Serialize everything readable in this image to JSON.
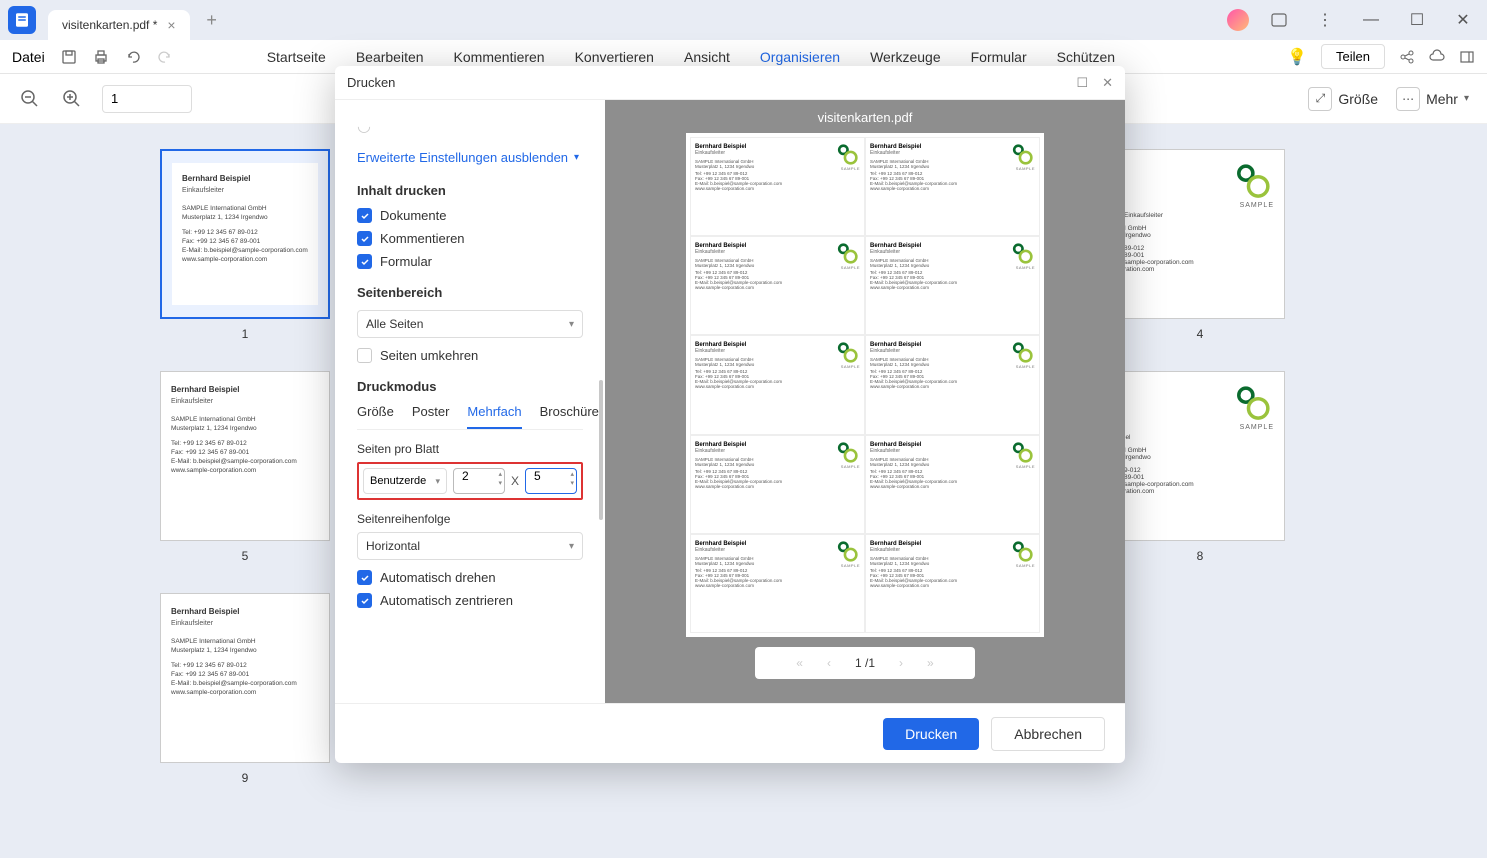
{
  "titlebar": {
    "tab_title": "visitenkarten.pdf *",
    "file_menu": "Datei"
  },
  "menu": {
    "start": "Startseite",
    "edit": "Bearbeiten",
    "comment": "Kommentieren",
    "convert": "Konvertieren",
    "view": "Ansicht",
    "organize": "Organisieren",
    "tools": "Werkzeuge",
    "form": "Formular",
    "protect": "Schützen",
    "share": "Teilen"
  },
  "sec": {
    "page_value": "1",
    "size": "Größe",
    "more": "Mehr"
  },
  "card": {
    "name": "Bernhard Beispiel",
    "role": "Einkaufsleiter",
    "company": "SAMPLE International GmbH",
    "address": "Musterplatz 1, 1234 Irgendwo",
    "tel": "Tel: +99 12 345 67 89-012",
    "fax": "Fax: +99 12 345 67 89-001",
    "email": "E-Mail: b.beispiel@sample-corporation.com",
    "web": "www.sample-corporation.com",
    "logo_text": "SAMPLE"
  },
  "thumbs": {
    "n1": "1",
    "n4": "4",
    "n5": "5",
    "n8": "8",
    "n9": "9"
  },
  "dialog": {
    "title": "Drucken",
    "advanced": "Erweiterte Einstellungen ausblenden",
    "content_title": "Inhalt drucken",
    "cb_documents": "Dokumente",
    "cb_comments": "Kommentieren",
    "cb_form": "Formular",
    "range_title": "Seitenbereich",
    "range_select": "Alle Seiten",
    "reverse": "Seiten umkehren",
    "mode_title": "Druckmodus",
    "tab_size": "Größe",
    "tab_poster": "Poster",
    "tab_multi": "Mehrfach",
    "tab_brochure": "Broschüre",
    "pages_per": "Seiten pro Blatt",
    "custom": "Benutzerde",
    "val_x": "2",
    "val_y": "5",
    "x_sep": "X",
    "order_title": "Seitenreihenfolge",
    "order_select": "Horizontal",
    "auto_rotate": "Automatisch drehen",
    "auto_center": "Automatisch zentrieren",
    "preview_file": "visitenkarten.pdf",
    "page_indicator": "1 /1",
    "btn_print": "Drucken",
    "btn_cancel": "Abbrechen"
  }
}
